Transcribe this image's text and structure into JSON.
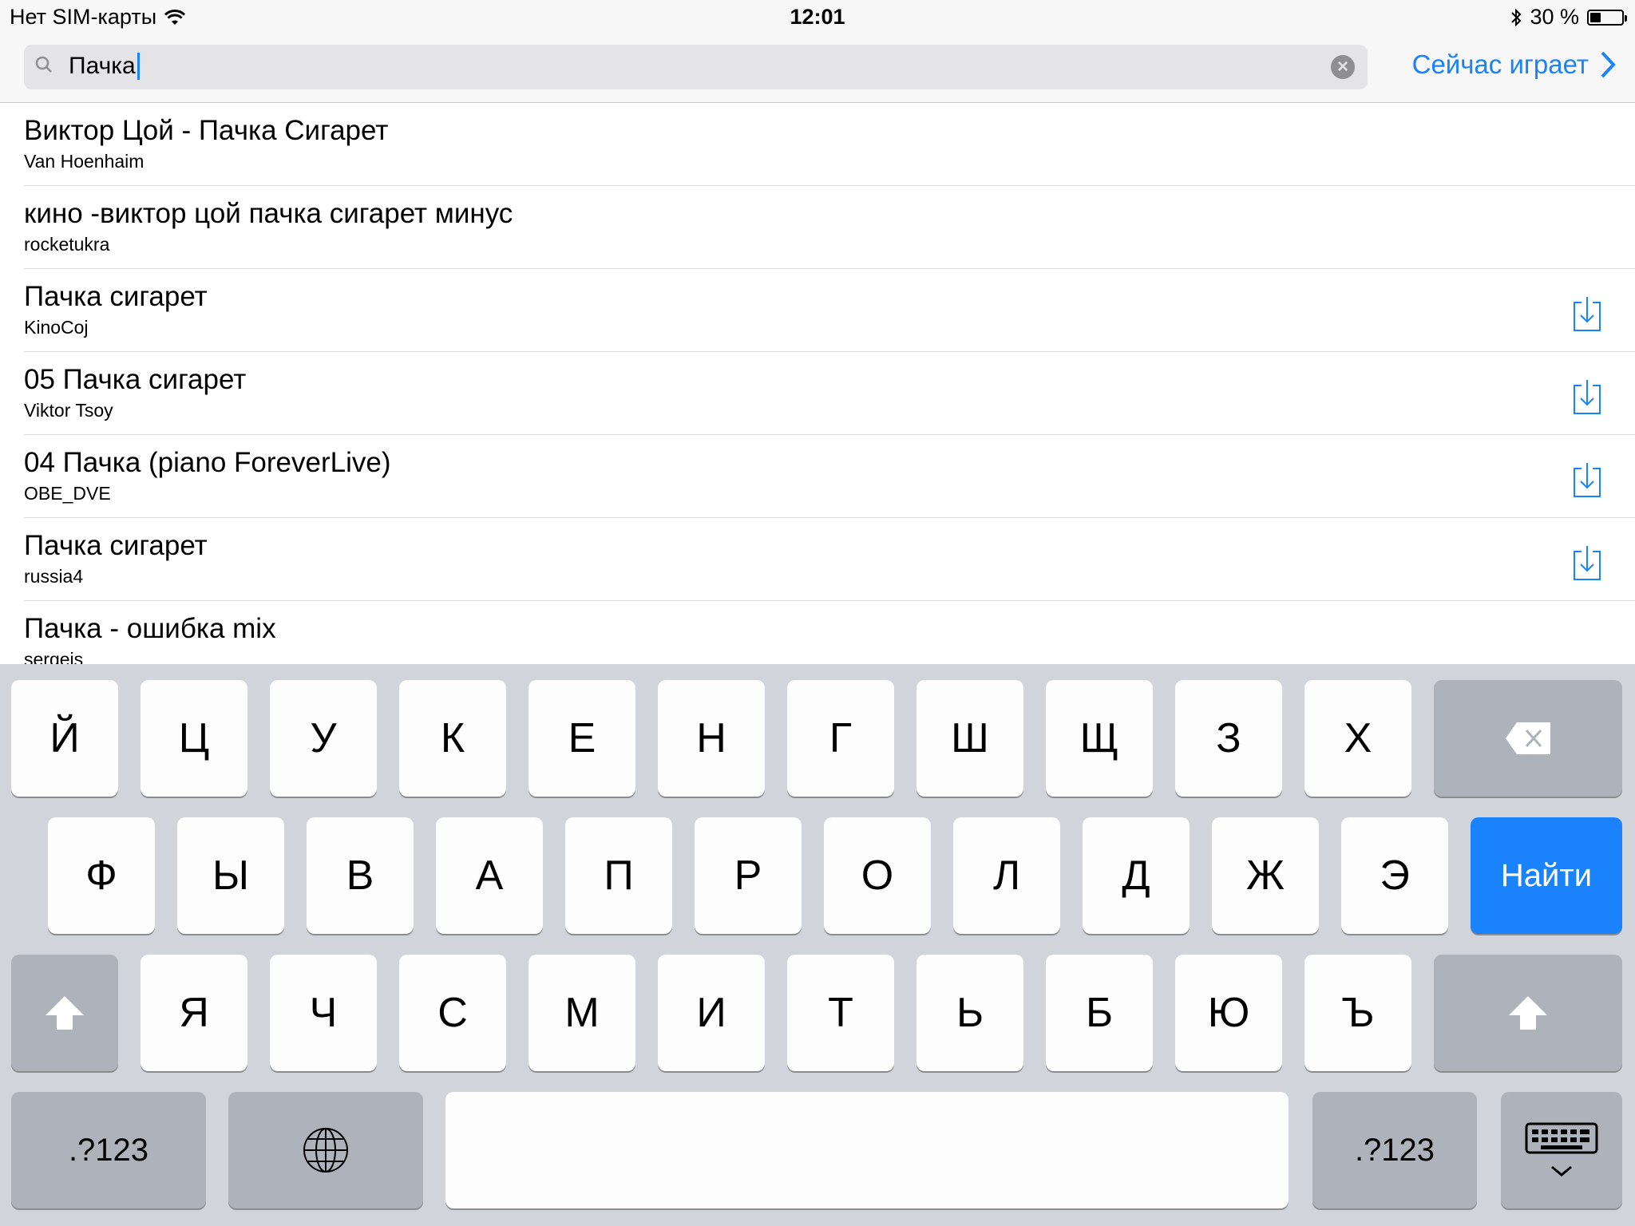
{
  "status_bar": {
    "carrier": "Нет SIM-карты",
    "time": "12:01",
    "battery_percent": "30 %",
    "battery_level": 0.3
  },
  "header": {
    "search_value": "Пачка",
    "now_playing_label": "Сейчас играет"
  },
  "results": [
    {
      "title": "Виктор Цой - Пачка Сигарет",
      "artist": "Van Hoenhaim",
      "downloadable": false
    },
    {
      "title": "кино -виктор цой пачка сигарет минус",
      "artist": "rocketukra",
      "downloadable": false
    },
    {
      "title": "Пачка сигарет",
      "artist": "KinoCoj",
      "downloadable": true
    },
    {
      "title": "05 Пачка сигарет",
      "artist": "Viktor Tsoy",
      "downloadable": true
    },
    {
      "title": "04 Пачка (piano ForeverLive)",
      "artist": "OBE_DVE",
      "downloadable": true
    },
    {
      "title": "Пачка сигарет",
      "artist": "russia4",
      "downloadable": true
    },
    {
      "title": "Пачка - ошибка mix",
      "artist": "sergeis",
      "downloadable": false
    }
  ],
  "keyboard": {
    "row1": [
      "Й",
      "Ц",
      "У",
      "К",
      "Е",
      "Н",
      "Г",
      "Ш",
      "Щ",
      "З",
      "Х"
    ],
    "row2": [
      "Ф",
      "Ы",
      "В",
      "А",
      "П",
      "Р",
      "О",
      "Л",
      "Д",
      "Ж",
      "Э"
    ],
    "row3": [
      "Я",
      "Ч",
      "С",
      "М",
      "И",
      "Т",
      "Ь",
      "Б",
      "Ю",
      "Ъ"
    ],
    "search_key": "Найти",
    "numbers_key": ".?123"
  },
  "colors": {
    "accent": "#1a82fb",
    "keyboard_bg": "#d1d5db",
    "key_dark": "#aeb3bb"
  },
  "icons": [
    "wifi-icon",
    "bluetooth-icon",
    "battery-icon",
    "search-icon",
    "clear-icon",
    "chevron-right-icon",
    "download-icon",
    "backspace-icon",
    "shift-icon",
    "globe-icon",
    "keyboard-hide-icon"
  ]
}
